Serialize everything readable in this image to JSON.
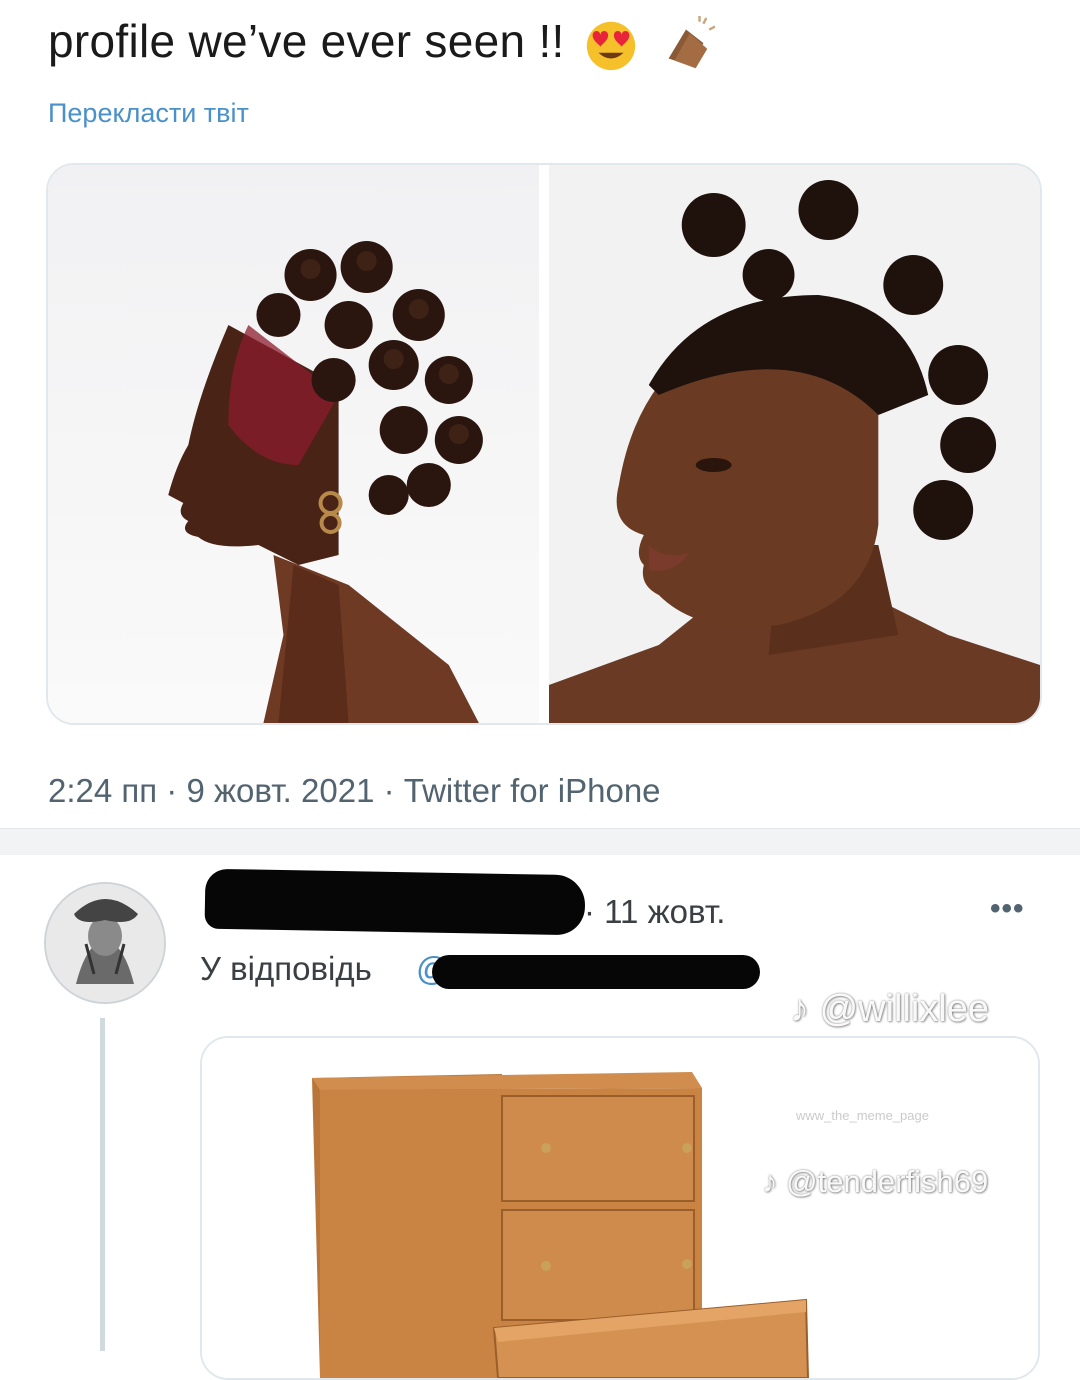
{
  "tweet": {
    "text": "profile we’ve ever seen !!",
    "emojis": [
      "heart-eyes-emoji",
      "clapping-hands-emoji"
    ],
    "translate_label": "Перекласти твіт",
    "meta": "2:24 пп · 9 жовт. 2021 · Twitter for iPhone",
    "media": [
      {
        "name": "photo-profile-left",
        "description_icon": "woman-profile-bantu-knots"
      },
      {
        "name": "photo-profile-right",
        "description_icon": "woman-three-quarter-bantu-knots"
      }
    ]
  },
  "reply": {
    "date": "· 11 жовт.",
    "reply_to_label": "У відповідь",
    "reply_handle_prefix": "@",
    "more_icon": "more-icon",
    "media_icon": "chest-of-drawers"
  },
  "watermarks": {
    "primary": "@willixlee",
    "secondary": "@tenderfish69",
    "tiny": "www_the_meme_page"
  },
  "colors": {
    "link": "#4a90c9",
    "muted": "#536471",
    "border": "#e1e8ed",
    "redaction": "#060606"
  }
}
